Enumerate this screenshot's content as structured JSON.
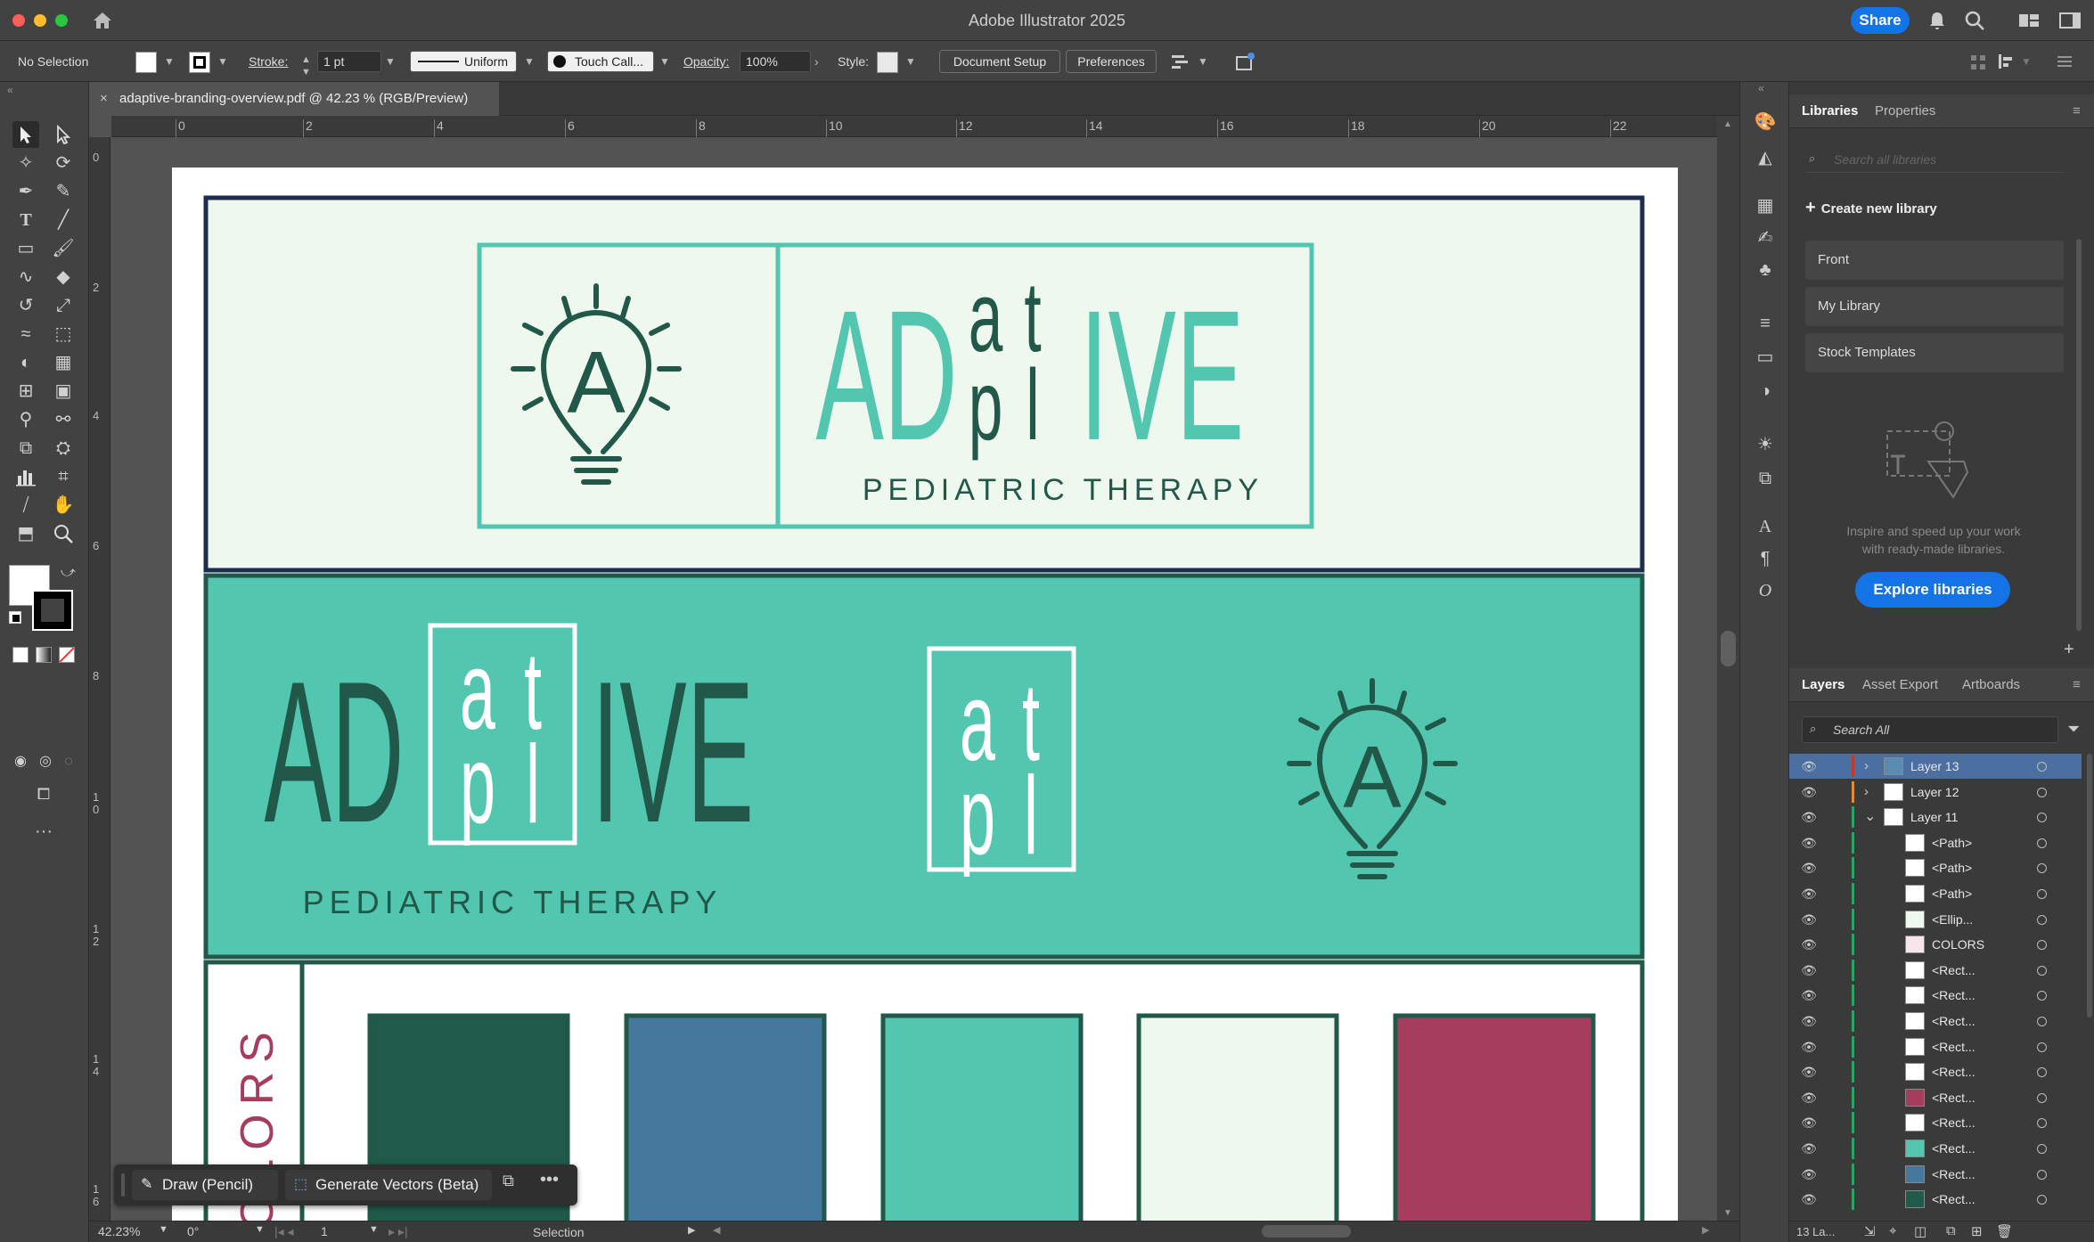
{
  "app": {
    "title": "Adobe Illustrator 2025",
    "share_label": "Share"
  },
  "control_bar": {
    "selection_state": "No Selection",
    "stroke_label": "Stroke:",
    "stroke_weight": "1 pt",
    "stroke_profile": "Uniform",
    "brush": "Touch Call...",
    "opacity_label": "Opacity:",
    "opacity_value": "100%",
    "style_label": "Style:",
    "document_setup_label": "Document Setup",
    "preferences_label": "Preferences"
  },
  "document": {
    "tab_title": "adaptive-branding-overview.pdf @ 42.23 % (RGB/Preview)"
  },
  "rulers": {
    "horizontal": [
      "0",
      "2",
      "4",
      "6",
      "8",
      "10",
      "12",
      "14",
      "16",
      "18",
      "20",
      "22"
    ],
    "vertical": [
      "0",
      "2",
      "4",
      "6",
      "8",
      "1\n0",
      "1\n2",
      "1\n4",
      "1\n6"
    ]
  },
  "artwork": {
    "brand_letters_ad": "AD",
    "brand_letters_a": "a",
    "brand_letters_t": "t",
    "brand_letters_p": "p",
    "brand_letters_l": "l",
    "brand_letters_ive": "IVE",
    "logo_icon_letter": "A",
    "tagline": "PEDIATRIC THERAPY",
    "colors_label": "COLORS",
    "brand_colors": {
      "dark_green": "#1f5a4a",
      "blue": "#44789c",
      "teal": "#52c6af",
      "mint": "#eff8ef",
      "raspberry": "#a63d5d",
      "navy": "#1d2d4f",
      "dark_teal_text": "#21584a"
    }
  },
  "floating_bar": {
    "draw_label": "Draw (Pencil)",
    "generate_label": "Generate Vectors (Beta)"
  },
  "status_bar": {
    "zoom": "42.23%",
    "rotation": "0°",
    "artboard_number": "1",
    "tool": "Selection"
  },
  "libraries_panel": {
    "tabs": [
      "Libraries",
      "Properties"
    ],
    "search_placeholder": "Search all libraries",
    "create_label": "Create new library",
    "libraries": [
      "Front",
      "My Library",
      "Stock Templates"
    ],
    "promo_text_line1": "Inspire and speed up your work",
    "promo_text_line2": "with ready-made libraries.",
    "explore_label": "Explore libraries"
  },
  "layers_panel": {
    "tabs": [
      "Layers",
      "Asset Export",
      "Artboards"
    ],
    "search_placeholder": "Search All",
    "layers": [
      {
        "name": "Layer 13",
        "level": 0,
        "expanded": false,
        "selected": true,
        "bar": "#c0392b",
        "thumb": "#5a8bb0"
      },
      {
        "name": "Layer 12",
        "level": 0,
        "expanded": false,
        "selected": false,
        "bar": "#e08a3c",
        "thumb": "#ffffff"
      },
      {
        "name": "Layer 11",
        "level": 0,
        "expanded": true,
        "selected": false,
        "bar": "#2aa36b",
        "thumb": "#ffffff"
      },
      {
        "name": "<Path>",
        "level": 1,
        "bar": "#2aa36b",
        "thumb": "#ffffff"
      },
      {
        "name": "<Path>",
        "level": 1,
        "bar": "#2aa36b",
        "thumb": "#ffffff"
      },
      {
        "name": "<Path>",
        "level": 1,
        "bar": "#2aa36b",
        "thumb": "#ffffff"
      },
      {
        "name": "<Ellip...",
        "level": 1,
        "bar": "#2aa36b",
        "thumb": "#eff8ef"
      },
      {
        "name": "COLORS",
        "level": 1,
        "bar": "#2aa36b",
        "thumb": "#f4e6ea"
      },
      {
        "name": "<Rect...",
        "level": 1,
        "bar": "#2aa36b",
        "thumb": "#ffffff"
      },
      {
        "name": "<Rect...",
        "level": 1,
        "bar": "#2aa36b",
        "thumb": "#ffffff"
      },
      {
        "name": "<Rect...",
        "level": 1,
        "bar": "#2aa36b",
        "thumb": "#ffffff"
      },
      {
        "name": "<Rect...",
        "level": 1,
        "bar": "#2aa36b",
        "thumb": "#ffffff"
      },
      {
        "name": "<Rect...",
        "level": 1,
        "bar": "#2aa36b",
        "thumb": "#ffffff"
      },
      {
        "name": "<Rect...",
        "level": 1,
        "bar": "#2aa36b",
        "thumb": "#a63d5d"
      },
      {
        "name": "<Rect...",
        "level": 1,
        "bar": "#2aa36b",
        "thumb": "#ffffff"
      },
      {
        "name": "<Rect...",
        "level": 1,
        "bar": "#2aa36b",
        "thumb": "#52c6af"
      },
      {
        "name": "<Rect...",
        "level": 1,
        "bar": "#2aa36b",
        "thumb": "#44789c"
      },
      {
        "name": "<Rect...",
        "level": 1,
        "bar": "#2aa36b",
        "thumb": "#1f5a4a"
      }
    ],
    "layer_count": "13 La..."
  }
}
